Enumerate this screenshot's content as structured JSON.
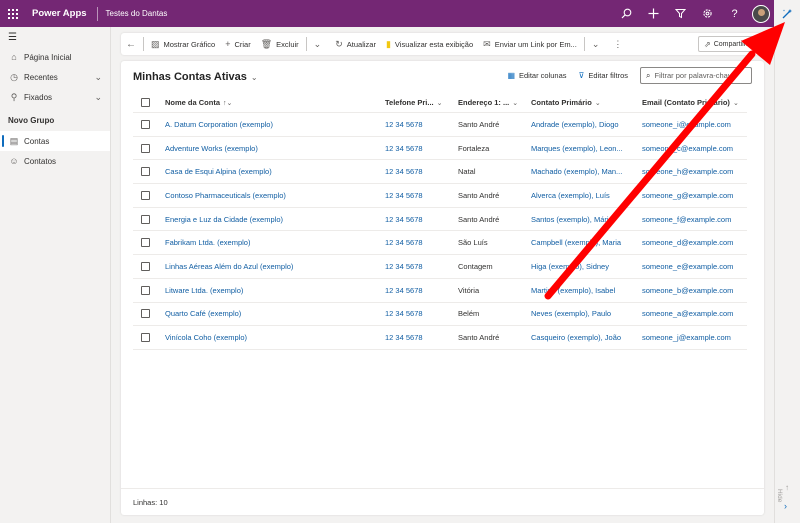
{
  "header": {
    "app_name": "Power Apps",
    "environment": "Testes do Dantas",
    "icons": [
      "search-icon",
      "plus-icon",
      "filter-icon",
      "gear-icon",
      "help-icon"
    ],
    "copilot_icon": "copilot-icon"
  },
  "nav": {
    "home": "Página Inicial",
    "recent": "Recentes",
    "pinned": "Fixados",
    "group": "Novo Grupo",
    "items": [
      {
        "label": "Contas",
        "selected": true
      },
      {
        "label": "Contatos",
        "selected": false
      }
    ]
  },
  "commands": {
    "show_chart": "Mostrar Gráfico",
    "create": "Criar",
    "delete": "Excluir",
    "refresh": "Atualizar",
    "visualize": "Visualizar esta exibição",
    "email_link": "Enviar um Link por Em...",
    "share": "Compartilhar"
  },
  "view": {
    "title": "Minhas Contas Ativas",
    "edit_columns": "Editar colunas",
    "edit_filters": "Editar filtros",
    "filter_placeholder": "Filtrar por palavra-chave"
  },
  "grid": {
    "columns": {
      "name": "Nome da Conta",
      "phone": "Telefone Pri...",
      "address": "Endereço 1: ...",
      "contact": "Contato Primário",
      "email": "Email (Contato Primário)"
    },
    "rows": [
      {
        "name": "A. Datum Corporation (exemplo)",
        "phone": "12 34 5678",
        "address": "Santo André",
        "contact": "Andrade (exemplo), Diogo",
        "email": "someone_i@example.com"
      },
      {
        "name": "Adventure Works (exemplo)",
        "phone": "12 34 5678",
        "address": "Fortaleza",
        "contact": "Marques (exemplo), Leon...",
        "email": "someone_c@example.com"
      },
      {
        "name": "Casa de Esqui Alpina (exemplo)",
        "phone": "12 34 5678",
        "address": "Natal",
        "contact": "Machado (exemplo), Man...",
        "email": "someone_h@example.com"
      },
      {
        "name": "Contoso Pharmaceuticals (exemplo)",
        "phone": "12 34 5678",
        "address": "Santo André",
        "contact": "Alverca (exemplo), Luís",
        "email": "someone_g@example.com"
      },
      {
        "name": "Energia e Luz da Cidade (exemplo)",
        "phone": "12 34 5678",
        "address": "Santo André",
        "contact": "Santos (exemplo), Mário",
        "email": "someone_f@example.com"
      },
      {
        "name": "Fabrikam Ltda. (exemplo)",
        "phone": "12 34 5678",
        "address": "São Luís",
        "contact": "Campbell (exemplo), Maria",
        "email": "someone_d@example.com"
      },
      {
        "name": "Linhas Aéreas Além do Azul (exemplo)",
        "phone": "12 34 5678",
        "address": "Contagem",
        "contact": "Higa (exemplo), Sidney",
        "email": "someone_e@example.com"
      },
      {
        "name": "Litware Ltda. (exemplo)",
        "phone": "12 34 5678",
        "address": "Vitória",
        "contact": "Martins (exemplo), Isabel",
        "email": "someone_b@example.com"
      },
      {
        "name": "Quarto Café (exemplo)",
        "phone": "12 34 5678",
        "address": "Belém",
        "contact": "Neves (exemplo), Paulo",
        "email": "someone_a@example.com"
      },
      {
        "name": "Vinícola Coho (exemplo)",
        "phone": "12 34 5678",
        "address": "Santo André",
        "contact": "Casqueiro (exemplo), João",
        "email": "someone_j@example.com"
      }
    ]
  },
  "footer": {
    "rows_label": "Linhas: 10"
  },
  "right_rail": {
    "hide_label": "Hide"
  },
  "colors": {
    "topbar": "#742774",
    "link": "#115ea3",
    "accent": "#0f6cbd",
    "annotation_arrow": "#ff0000"
  }
}
